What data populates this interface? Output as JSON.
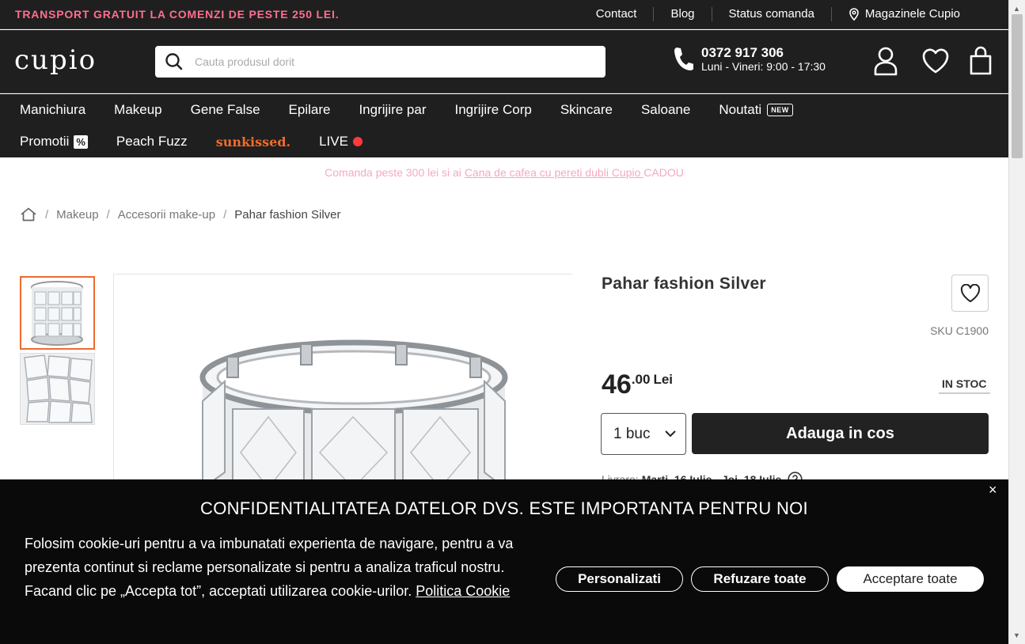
{
  "topbar": {
    "promo": "TRANSPORT GRATUIT LA COMENZI DE PESTE 250 LEI.",
    "links": [
      "Contact",
      "Blog",
      "Status comanda",
      "Magazinele Cupio"
    ]
  },
  "header": {
    "logo": "cupio",
    "search_placeholder": "Cauta produsul dorit",
    "phone_number": "0372 917 306",
    "phone_hours": "Luni - Vineri: 9:00 - 17:30"
  },
  "nav": {
    "row1": [
      "Manichiura",
      "Makeup",
      "Gene False",
      "Epilare",
      "Ingrijire par",
      "Ingrijire Corp",
      "Skincare",
      "Saloane",
      "Noutati"
    ],
    "new_badge": "NEW",
    "promotii": "Promotii",
    "promotii_badge": "%",
    "peach": "Peach Fuzz",
    "sunkissed": "sunkissed.",
    "live": "LIVE"
  },
  "gift": {
    "before": "Comanda peste 300 lei si ai ",
    "link": "Cana de cafea cu pereti dubli Cupio ",
    "after": "CADOU"
  },
  "breadcrumb": {
    "items": [
      "Makeup",
      "Accesorii make-up"
    ],
    "current": "Pahar fashion Silver"
  },
  "product": {
    "title": "Pahar fashion Silver",
    "sku": "SKU C1900",
    "price_int": "46",
    "price_dec": ".00",
    "currency": "Lei",
    "stock": "IN STOC",
    "qty": "1 buc",
    "add_to_cart": "Adauga in cos",
    "delivery_label": "Livrare:",
    "delivery_dates": "Marti, 16 Iulie - Joi, 18 Iulie"
  },
  "cookie": {
    "title": "CONFIDENTIALITATEA DATELOR DVS. ESTE IMPORTANTA PENTRU NOI",
    "text": "Folosim cookie-uri pentru a va imbunatati experienta de navigare, pentru a va prezenta continut si reclame personalizate si pentru a analiza traficul nostru. Facand clic pe „Accepta tot”, acceptati utilizarea cookie-urilor. ",
    "policy_link": "Politica Cookie",
    "btn_customize": "Personalizati",
    "btn_reject": "Refuzare toate",
    "btn_accept": "Acceptare toate",
    "close": "×"
  },
  "colors": {
    "dark": "#1f1f1f",
    "promo_pink": "#ff6f8e",
    "accent_orange": "#ef6a2f",
    "live_red": "#ff3b3b"
  }
}
